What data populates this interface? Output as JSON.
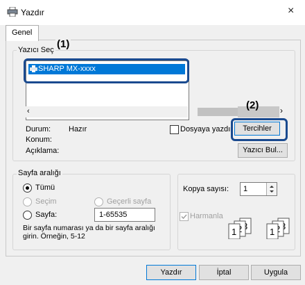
{
  "window": {
    "title": "Yazdır",
    "close_symbol": "×"
  },
  "tabs": [
    {
      "label": "Genel"
    }
  ],
  "printer_group": {
    "label": "Yazıcı Seç",
    "printer_name": "SHARP MX-xxxx"
  },
  "callouts": {
    "first": "(1)",
    "second": "(2)"
  },
  "status": {
    "state_label": "Durum:",
    "state_value": "Hazır",
    "location_label": "Konum:",
    "comment_label": "Açıklama:"
  },
  "options": {
    "print_to_file_label": "Dosyaya yazdır",
    "preferences_button": "Tercihler",
    "find_printer_button": "Yazıcı Bul..."
  },
  "page_range": {
    "label": "Sayfa aralığı",
    "all": "Tümü",
    "selection": "Seçim",
    "current_page": "Geçerli sayfa",
    "pages": "Sayfa:",
    "pages_value": "1-65535",
    "hint": "Bir sayfa numarası ya da bir sayfa aralığı girin.  Örneğin, 5-12"
  },
  "copies": {
    "label": "Kopya sayısı:",
    "value": "1",
    "collate_label": "Harmanla",
    "collate_checked": true
  },
  "footer": {
    "print": "Yazdır",
    "cancel": "İptal",
    "apply": "Uygula"
  }
}
